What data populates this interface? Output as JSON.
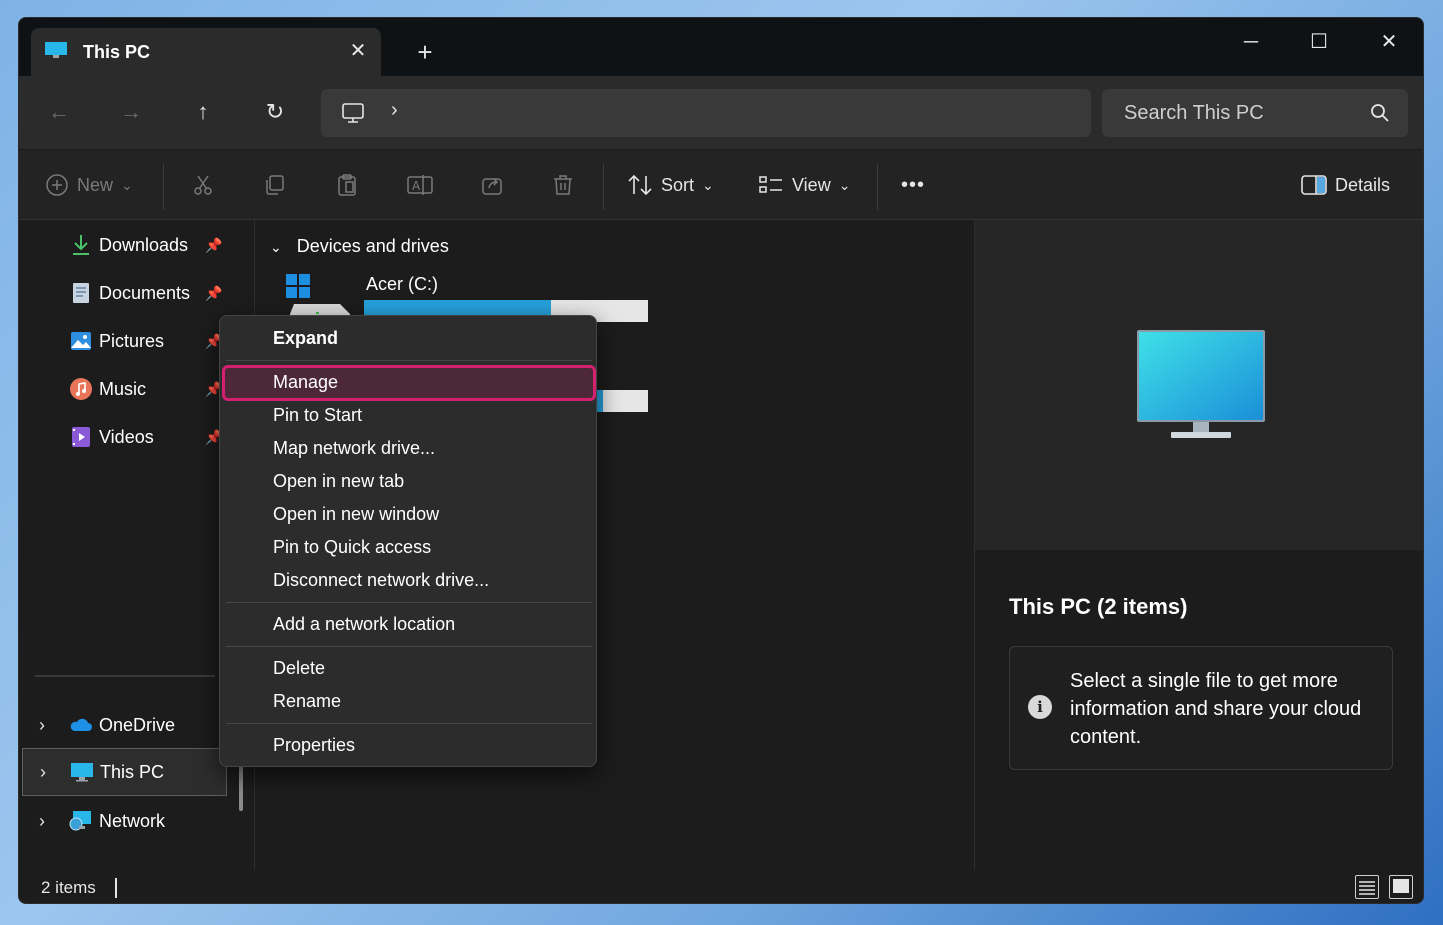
{
  "window": {
    "tab_title": "This PC",
    "close_tab_glyph": "✕",
    "new_tab_glyph": "+",
    "minimize_glyph": "─",
    "maximize_glyph": "☐",
    "close_glyph": "✕"
  },
  "nav": {
    "back_glyph": "←",
    "forward_glyph": "→",
    "up_glyph": "↑",
    "refresh_glyph": "↻",
    "breadcrumb_chevron": "›",
    "search_placeholder": "Search This PC"
  },
  "commandbar": {
    "new_label": "New",
    "sort_label": "Sort",
    "view_label": "View",
    "more_glyph": "•••",
    "details_label": "Details",
    "dropdown_glyph": "⌄"
  },
  "sidebar": {
    "quick_access": [
      {
        "label": "Downloads",
        "icon": "download-icon"
      },
      {
        "label": "Documents",
        "icon": "document-icon"
      },
      {
        "label": "Pictures",
        "icon": "pictures-icon"
      },
      {
        "label": "Music",
        "icon": "music-icon"
      },
      {
        "label": "Videos",
        "icon": "videos-icon"
      }
    ],
    "pin_glyph": "📌",
    "chevron_glyph": "›",
    "locations": [
      {
        "label": "OneDrive",
        "icon": "onedrive-icon"
      },
      {
        "label": "This PC",
        "icon": "this-pc-icon",
        "selected": true
      },
      {
        "label": "Network",
        "icon": "network-icon"
      }
    ]
  },
  "main": {
    "group_header": "Devices and drives",
    "group_chevron": "⌄",
    "drives": [
      {
        "label": "Acer (C:)",
        "used_fraction": 0.66
      },
      {
        "label": "",
        "used_fraction": 0.84
      }
    ]
  },
  "context_menu": {
    "items": [
      {
        "label": "Expand",
        "bold": true
      },
      {
        "label": "Manage",
        "highlighted": true
      },
      {
        "label": "Pin to Start"
      },
      {
        "label": "Map network drive..."
      },
      {
        "label": "Open in new tab"
      },
      {
        "label": "Open in new window"
      },
      {
        "label": "Pin to Quick access"
      },
      {
        "label": "Disconnect network drive..."
      },
      {
        "label": "Add a network location"
      },
      {
        "label": "Delete"
      },
      {
        "label": "Rename"
      },
      {
        "label": "Properties"
      }
    ]
  },
  "details_pane": {
    "title": "This PC (2 items)",
    "info_glyph": "i",
    "info_text": "Select a single file to get more information and share your cloud content."
  },
  "statusbar": {
    "item_count": "2 items"
  },
  "colors": {
    "accent_highlight": "#d4216f",
    "drive_bar": "#26a0da"
  }
}
